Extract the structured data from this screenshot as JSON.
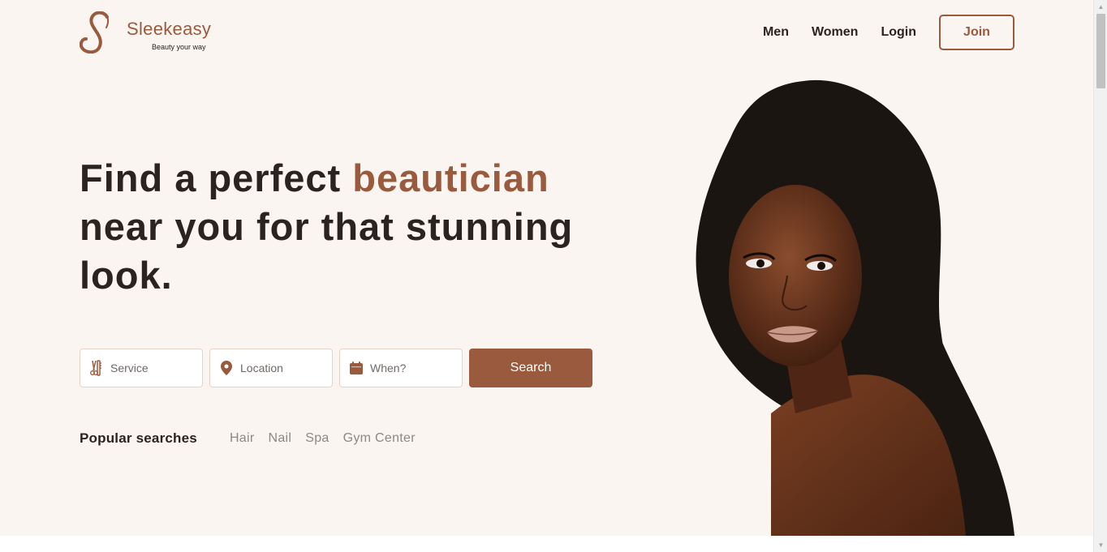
{
  "brand": {
    "name": "Sleekeasy",
    "tagline": "Beauty your way",
    "accent_color": "#9a5a3e"
  },
  "nav": {
    "men": "Men",
    "women": "Women",
    "login": "Login",
    "join": "Join"
  },
  "hero": {
    "headline_before": "Find a perfect ",
    "headline_accent": "beautician",
    "headline_after": " near you for that stunning look."
  },
  "search": {
    "service_placeholder": "Service",
    "location_placeholder": "Location",
    "when_placeholder": "When?",
    "button_label": "Search",
    "service_icon": "scissors-comb-icon",
    "location_icon": "map-pin-icon",
    "when_icon": "calendar-icon"
  },
  "popular": {
    "label": "Popular searches",
    "tags": [
      "Hair",
      "Nail",
      "Spa",
      "Gym Center"
    ]
  },
  "scrollbar": {
    "position_fraction": 0.0
  }
}
